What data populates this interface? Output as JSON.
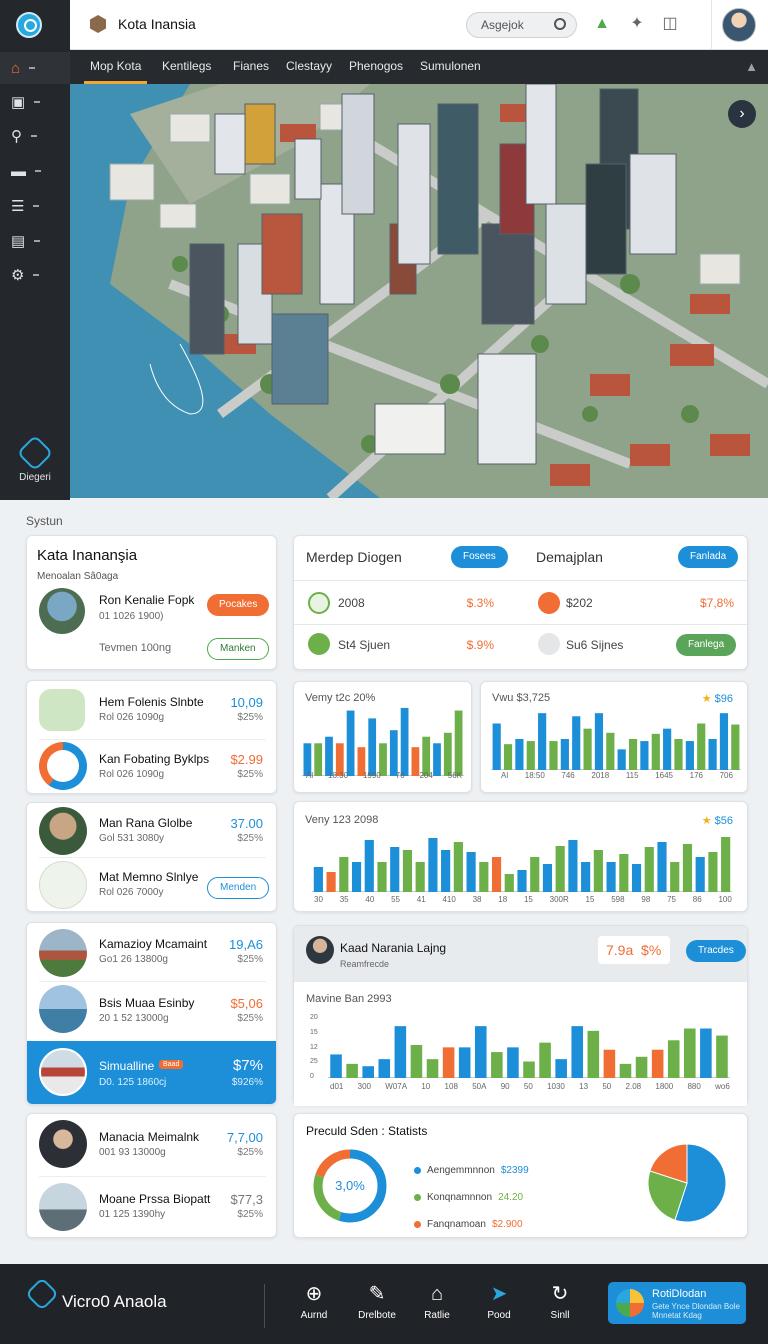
{
  "app": {
    "title": "Kota Inansia",
    "search_placeholder": "Asgejok",
    "brand": "Vicro0 Anaola"
  },
  "sidebar": {
    "items": [
      {
        "icon": "home-icon"
      },
      {
        "icon": "terminal-icon"
      },
      {
        "icon": "user-icon"
      },
      {
        "icon": "bus-icon"
      },
      {
        "icon": "list-icon"
      },
      {
        "icon": "chart-icon"
      },
      {
        "icon": "settings-icon"
      }
    ],
    "bottom_label": "Diegeri"
  },
  "tabs": [
    "Mop Kota",
    "Kentilegs",
    "Fianes",
    "Clestayy",
    "Phenogos",
    "Sumulonen"
  ],
  "section_title": "Systun",
  "profile_card": {
    "title": "Kata Inananşia",
    "subtitle": "Menoalan Sâ0aga",
    "item_title": "Ron Kenalie Fopk",
    "item_sub": "01 1026 1900)",
    "badge": "Pocakes",
    "footer": "Tevmen 100ng",
    "action": "Manken"
  },
  "summary": {
    "left_title": "Merdep Diogen",
    "left_pill": "Fosees",
    "right_title": "Demajplan",
    "right_pill": "Fanlada",
    "rows": [
      {
        "label": "2008",
        "value": "$.3%",
        "label2": "$202",
        "value2": "$7,8%"
      },
      {
        "label": "St4 Sjuen",
        "value": "$.9%",
        "label2": "Su6 Sijnes",
        "value2": "",
        "pill": "Fanlega"
      }
    ]
  },
  "list_a": [
    {
      "title": "Hem Folenis Slnbte",
      "sub": "Rol 026 1090g",
      "value": "10,09",
      "value2": "$25%"
    },
    {
      "title": "Kan Fobating Byklps",
      "sub": "Rol 026 1090g",
      "value": "$2.99",
      "value2": "$25%"
    }
  ],
  "list_b": [
    {
      "title": "Man Rana Glolbe",
      "sub": "Gol 531 3080y",
      "value": "37.00",
      "value2": "$25%"
    },
    {
      "title": "Mat Memno Slnlye",
      "sub": "Rol 026 7000y",
      "action": "Menden"
    }
  ],
  "list_c": [
    {
      "title": "Kamazioy Mcamaint",
      "sub": "Go1 26 13800g",
      "value": "19,A6",
      "value2": "$25%"
    },
    {
      "title": "Bsis Muaa Esinby",
      "sub": "20 1 52 13000g",
      "value": "$5,06",
      "value2": "$25%"
    },
    {
      "title": "Simualline",
      "badge": "Baad",
      "sub": "D0. 125 1860cj",
      "value": "$7%",
      "value2": "$926%"
    }
  ],
  "list_d": [
    {
      "title": "Manacia Meimalnk",
      "sub": "001 93 13000g",
      "value": "7,7,00",
      "value2": "$25%"
    },
    {
      "title": "Moane Prssa Biopatt",
      "sub": "01 125 1390hy",
      "value": "$77,3",
      "value2": "$25%"
    }
  ],
  "charts": {
    "small_left": {
      "caption": "Vemy t2c 20%",
      "ticks": [
        "Al",
        "18:30",
        "1990",
        "76",
        "204",
        "56K"
      ]
    },
    "small_right": {
      "caption": "Vwu $3,725",
      "star_value": "$96",
      "ticks": [
        "Al",
        "18:50",
        "746",
        "2018",
        "115",
        "1645",
        "176",
        "706"
      ]
    },
    "wide": {
      "caption": "Veny 123 2098",
      "star_value": "$56",
      "ticks": [
        "30",
        "35",
        "40",
        "55",
        "41",
        "410",
        "38",
        "18",
        "15",
        "300R",
        "15",
        "598",
        "98",
        "75",
        "86",
        "100"
      ]
    },
    "detail": {
      "title": "Kaad Narania Lajng",
      "subtitle": "Reamfrecde",
      "value": "7.9a",
      "pct": "$%",
      "pill": "Tracdes",
      "caption": "Mavine Ban 2993",
      "yticks": [
        "20",
        "15",
        "12",
        "25",
        "0"
      ],
      "ticks": [
        "d01",
        "300",
        "W07A",
        "10",
        "108",
        "50A",
        "90",
        "50",
        "1030",
        "13",
        "50",
        "2.08",
        "1800",
        "880",
        "wo6"
      ]
    }
  },
  "chart_data": [
    {
      "type": "bar",
      "title": "",
      "xlabel": "",
      "ylabel": "",
      "categories": [
        "Al",
        "18:30",
        "1990",
        "76",
        "204",
        "56K"
      ],
      "ylim": [
        0,
        55
      ],
      "values": [
        25,
        25,
        30,
        25,
        50,
        22,
        44,
        25,
        35,
        52,
        22,
        30,
        25,
        33,
        50
      ],
      "colors": [
        "#1d8fd8",
        "#6db04a",
        "#1d8fd8",
        "#f06d34",
        "#1d8fd8",
        "#f06d34",
        "#1d8fd8",
        "#6db04a",
        "#1d8fd8",
        "#1d8fd8",
        "#f06d34",
        "#6db04a",
        "#1d8fd8",
        "#6db04a",
        "#6db04a"
      ]
    },
    {
      "type": "bar",
      "title": "",
      "xlabel": "",
      "ylabel": "",
      "categories": [
        "Al",
        "18:50",
        "746",
        "2018",
        "115",
        "1645",
        "176",
        "706"
      ],
      "ylim": [
        0,
        60
      ],
      "values": [
        45,
        25,
        30,
        28,
        55,
        28,
        30,
        52,
        40,
        55,
        36,
        20,
        30,
        28,
        35,
        40,
        30,
        28,
        45,
        30,
        55,
        44
      ],
      "colors": [
        "#1d8fd8",
        "#6db04a",
        "#1d8fd8",
        "#6db04a",
        "#1d8fd8",
        "#6db04a",
        "#1d8fd8",
        "#1d8fd8",
        "#6db04a",
        "#1d8fd8",
        "#6db04a",
        "#1d8fd8",
        "#6db04a",
        "#1d8fd8",
        "#6db04a",
        "#1d8fd8",
        "#6db04a",
        "#1d8fd8",
        "#6db04a",
        "#1d8fd8",
        "#1d8fd8",
        "#6db04a"
      ]
    },
    {
      "type": "bar",
      "title": "",
      "xlabel": "",
      "ylabel": "",
      "categories": [
        "30",
        "35",
        "40",
        "55",
        "41",
        "410",
        "38",
        "18",
        "15",
        "300R",
        "15",
        "598",
        "98",
        "75",
        "86",
        "100"
      ],
      "ylim": [
        0,
        60
      ],
      "values": [
        25,
        20,
        35,
        30,
        52,
        30,
        45,
        42,
        30,
        54,
        42,
        50,
        40,
        30,
        35,
        18,
        22,
        35,
        28,
        46,
        52,
        30,
        42,
        30,
        38,
        28,
        45,
        50,
        30,
        48,
        35,
        40,
        55
      ],
      "colors": [
        "#1d8fd8",
        "#f06d34",
        "#6db04a",
        "#1d8fd8",
        "#1d8fd8",
        "#6db04a",
        "#1d8fd8",
        "#6db04a",
        "#6db04a",
        "#1d8fd8",
        "#1d8fd8",
        "#6db04a",
        "#1d8fd8",
        "#6db04a",
        "#f06d34",
        "#6db04a",
        "#1d8fd8",
        "#6db04a",
        "#1d8fd8",
        "#6db04a",
        "#1d8fd8",
        "#1d8fd8",
        "#6db04a",
        "#1d8fd8",
        "#6db04a",
        "#1d8fd8",
        "#6db04a",
        "#1d8fd8",
        "#6db04a",
        "#6db04a",
        "#1d8fd8",
        "#6db04a",
        "#6db04a"
      ]
    },
    {
      "type": "bar",
      "title": "Mavine Ban 2993",
      "xlabel": "",
      "ylabel": "",
      "categories": [
        "d01",
        "300",
        "W07A",
        "10",
        "108",
        "50A",
        "90",
        "50",
        "1030",
        "13",
        "50",
        "2.08",
        "1800",
        "880",
        "wo6"
      ],
      "ylim": [
        0,
        28
      ],
      "values": [
        10,
        6,
        5,
        8,
        22,
        14,
        8,
        13,
        13,
        22,
        11,
        13,
        7,
        15,
        8,
        22,
        20,
        12,
        6,
        9,
        12,
        16,
        21,
        21,
        18
      ],
      "colors": [
        "#1d8fd8",
        "#6db04a",
        "#1d8fd8",
        "#1d8fd8",
        "#1d8fd8",
        "#6db04a",
        "#6db04a",
        "#f06d34",
        "#1d8fd8",
        "#1d8fd8",
        "#6db04a",
        "#1d8fd8",
        "#6db04a",
        "#6db04a",
        "#1d8fd8",
        "#1d8fd8",
        "#6db04a",
        "#f06d34",
        "#6db04a",
        "#6db04a",
        "#f06d34",
        "#6db04a",
        "#6db04a",
        "#1d8fd8",
        "#6db04a"
      ]
    },
    {
      "type": "pie",
      "title": "Preculd Sden : Statists",
      "center_label": "3,0%",
      "slices": [
        {
          "label": "Aengemmnnon",
          "value": "$2399",
          "share": 0.55,
          "color": "#1d8fd8"
        },
        {
          "label": "Konqnamnnon",
          "value": "24.20",
          "share": 0.25,
          "color": "#6db04a"
        },
        {
          "label": "Fanqnamoan",
          "value": "$2.900",
          "share": 0.2,
          "color": "#f06d34"
        }
      ]
    }
  ],
  "bottom_nav": [
    {
      "label": "Aurnd",
      "icon": "plus-circle-icon"
    },
    {
      "label": "Drelbote",
      "icon": "edit-icon"
    },
    {
      "label": "Ratlie",
      "icon": "lock-icon"
    },
    {
      "label": "Pood",
      "icon": "send-icon"
    },
    {
      "label": "Sinll",
      "icon": "refresh-icon"
    }
  ],
  "promo": {
    "title": "RotiDlodan",
    "sub": "Gete Ynce Dlondan Bole Mnnetat Kdag"
  }
}
